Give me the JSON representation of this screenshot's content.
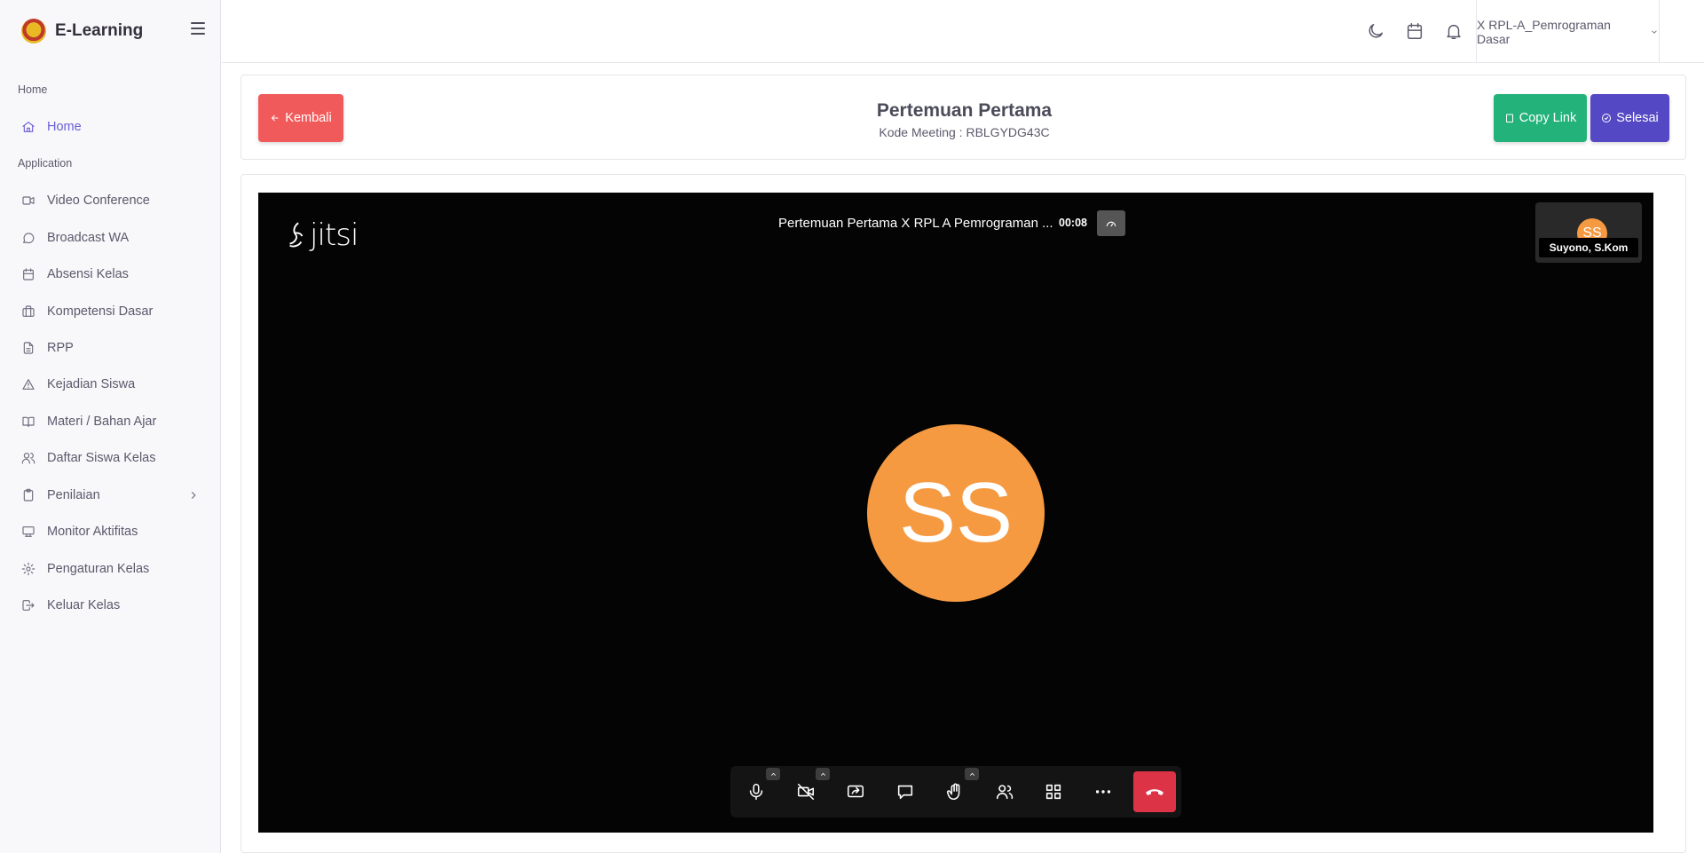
{
  "app": {
    "brand_name": "E-Learning",
    "logo_icon": "school-emblem-icon"
  },
  "sidebar": {
    "section_home": "Home",
    "section_application": "Application",
    "home_item": {
      "label": "Home",
      "icon": "home-icon",
      "active": true
    },
    "items": [
      {
        "label": "Video Conference",
        "icon": "video-icon"
      },
      {
        "label": "Broadcast WA",
        "icon": "chat-bubble-icon"
      },
      {
        "label": "Absensi Kelas",
        "icon": "calendar-icon"
      },
      {
        "label": "Kompetensi Dasar",
        "icon": "briefcase-icon"
      },
      {
        "label": "RPP",
        "icon": "document-icon"
      },
      {
        "label": "Kejadian Siswa",
        "icon": "alert-triangle-icon"
      },
      {
        "label": "Materi / Bahan Ajar",
        "icon": "book-open-icon"
      },
      {
        "label": "Daftar Siswa Kelas",
        "icon": "users-icon"
      },
      {
        "label": "Penilaian",
        "icon": "clipboard-icon",
        "has_submenu": true
      },
      {
        "label": "Monitor Aktifitas",
        "icon": "monitor-icon"
      },
      {
        "label": "Pengaturan Kelas",
        "icon": "gear-icon"
      },
      {
        "label": "Keluar Kelas",
        "icon": "logout-icon"
      }
    ]
  },
  "topbar": {
    "class_selector": "X RPL-A_Pemrograman Dasar",
    "icons": [
      "moon-icon",
      "calendar-icon",
      "bell-icon"
    ]
  },
  "meeting": {
    "back_label": "Kembali",
    "title": "Pertemuan Pertama",
    "code_text": "Kode Meeting : RBLGYDG43C",
    "copy_label": "Copy Link",
    "done_label": "Selesai"
  },
  "jitsi": {
    "logo_text": "jitsi",
    "conference_title": "Pertemuan Pertama X RPL A Pemrograman ...",
    "timer": "00:08",
    "participant_initials": "SS",
    "participant_name": "Suyono, S.Kom",
    "toolbar": [
      "microphone-icon",
      "camera-off-icon",
      "screen-share-icon",
      "chat-icon",
      "raise-hand-icon",
      "participants-icon",
      "tile-view-icon",
      "more-icon",
      "hangup-icon"
    ]
  },
  "colors": {
    "accent": "#6a5fd6",
    "danger": "#f15a5a",
    "success": "#23b37a",
    "primary": "#5548c4",
    "avatar": "#f69a42",
    "hangup": "#dd3347"
  }
}
